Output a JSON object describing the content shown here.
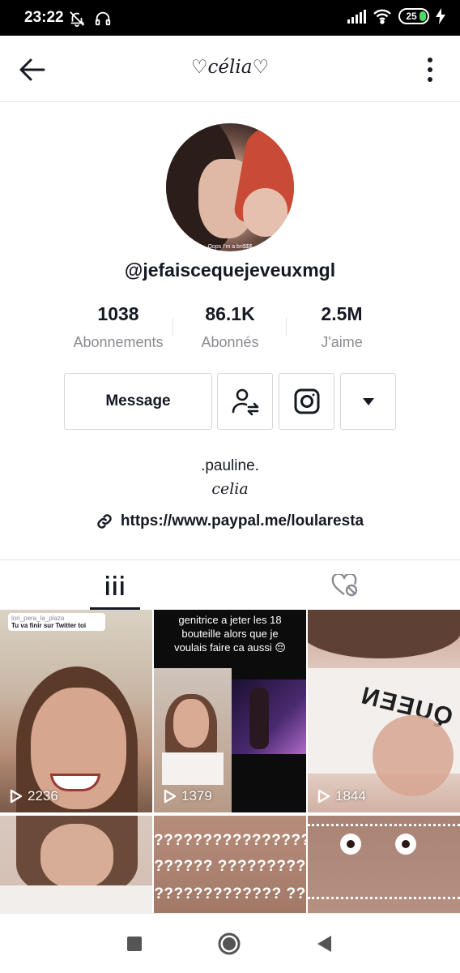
{
  "status_bar": {
    "time": "23:22",
    "battery": "25"
  },
  "header": {
    "title": "♡célia♡"
  },
  "profile": {
    "avatar_caption": "Oops I'm a bri$$$",
    "username": "@jefaiscequejeveuxmgl",
    "stats": [
      {
        "value": "1038",
        "label": "Abonnements"
      },
      {
        "value": "86.1K",
        "label": "Abonnés"
      },
      {
        "value": "2.5M",
        "label": "J'aime"
      }
    ],
    "message_label": "Message",
    "bio_line1": ".pauline.",
    "bio_line2": "celia",
    "link": "https://www.paypal.me/loularesta"
  },
  "grid": {
    "tiles": [
      {
        "views": "2236",
        "caption": "Tu va finir sur Twitter toi",
        "caption_user": "lori_pera_la_plaza"
      },
      {
        "views": "1379",
        "caption": "genitrice a jeter les 18 bouteille alors que je voulais faire ca aussi 😔"
      },
      {
        "views": "1844"
      },
      {
        "views": ""
      },
      {
        "views": "",
        "overlay_lines": [
          "????????????????",
          "?????? ?????????",
          "????????????? ??"
        ]
      },
      {
        "views": ""
      }
    ]
  },
  "colors": {
    "text": "#161823",
    "secondary": "#8a8b91",
    "border": "#e3e3e4"
  }
}
